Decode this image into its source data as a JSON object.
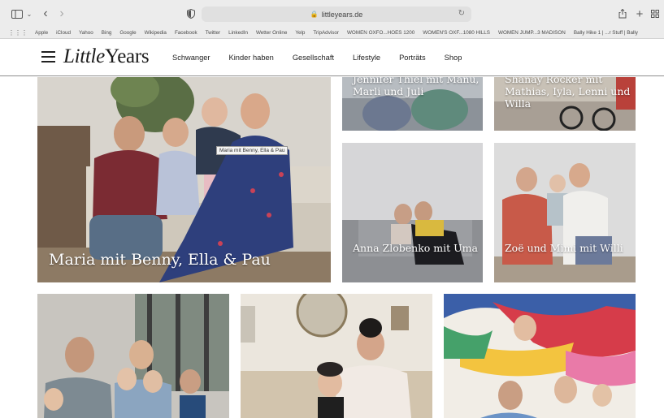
{
  "browser": {
    "url": "littleyears.de",
    "bookmarks": [
      "Apple",
      "iCloud",
      "Yahoo",
      "Bing",
      "Google",
      "Wikipedia",
      "Facebook",
      "Twitter",
      "LinkedIn",
      "Wetter Online",
      "Yelp",
      "TripAdvisor",
      "WOMEN OXFO...HOES 1200",
      "WOMEN'S OXF...1080 HILLS",
      "WOMEN JUMP...3 MADISON",
      "Bally Hike 1 | ...r Stuff | Bally"
    ]
  },
  "site": {
    "logo_part1": "Little",
    "logo_part2": "Years",
    "nav": [
      "Schwanger",
      "Kinder haben",
      "Gesellschaft",
      "Lifestyle",
      "Porträts",
      "Shop"
    ]
  },
  "tiles": {
    "hero_caption": "Maria mit Benny, Ella & Pau",
    "hero_tooltip": "Maria mit Benny, Ella & Pau",
    "top_mid_caption": "Jennifer Thiel mit Manu, Marli und Juli",
    "top_right_caption": "Shanay Rocker mit Mathias, Iyla, Lenni und Willa",
    "mid_mid_caption": "Anna Zlobenko mit Uma",
    "mid_right_caption": "Zoë und Mimi mit Willi"
  },
  "colors": {
    "tab_bg": "#ececec",
    "nav_text": "#222222",
    "caption_text": "#ffffff"
  }
}
